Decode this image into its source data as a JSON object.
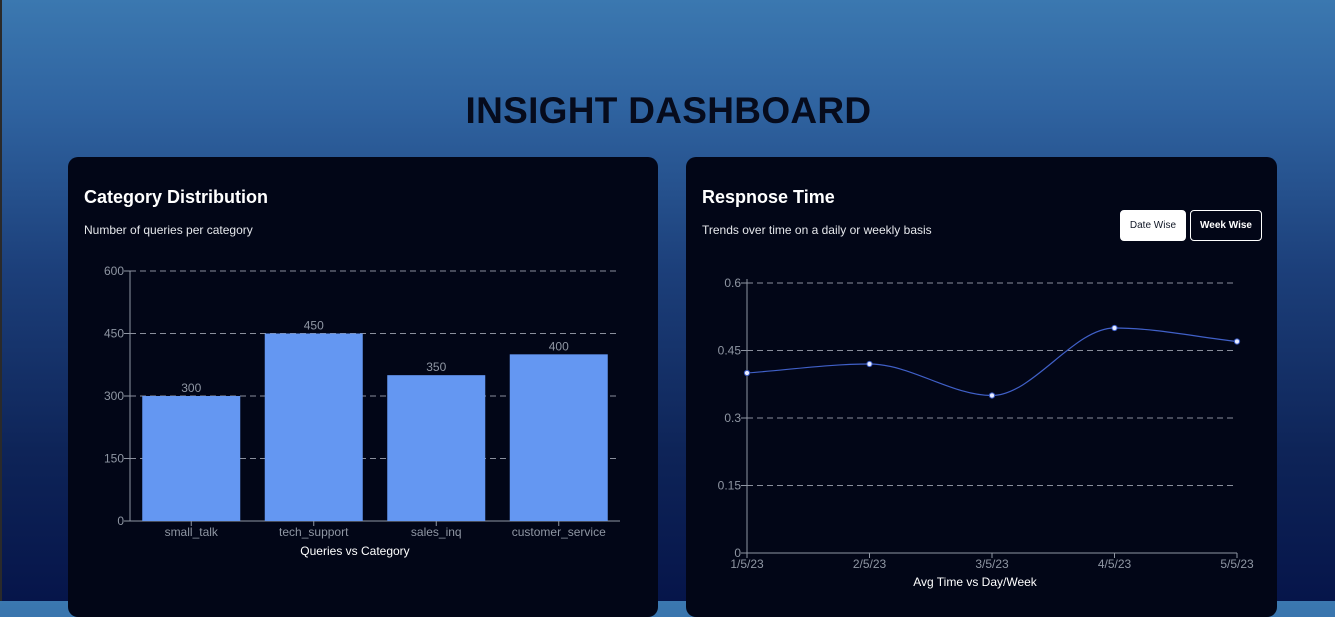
{
  "page": {
    "title": "INSIGHT DASHBOARD"
  },
  "category_card": {
    "title": "Category Distribution",
    "subtitle": "Number of queries per category"
  },
  "response_card": {
    "title": "Respnose Time",
    "subtitle": "Trends over time on a daily or weekly basis",
    "buttons": {
      "date_wise": "Date Wise",
      "week_wise": "Week Wise"
    }
  },
  "colors": {
    "bar": "#6497f2",
    "line": "#4060c8",
    "point": "#e8ecff",
    "grid": "#8a8f9c",
    "tick": "#8f96a3"
  },
  "chart_data": [
    {
      "type": "bar",
      "categories": [
        "small_talk",
        "tech_support",
        "sales_inq",
        "customer_service"
      ],
      "values": [
        300,
        450,
        350,
        400
      ],
      "data_labels": [
        "300",
        "450",
        "350",
        "400"
      ],
      "xlabel": "Queries vs Category",
      "ylabel": "",
      "ylim": [
        0,
        600
      ],
      "yticks": [
        "0",
        "150",
        "300",
        "450",
        "600"
      ],
      "grid": true
    },
    {
      "type": "line",
      "x": [
        "1/5/23",
        "2/5/23",
        "3/5/23",
        "4/5/23",
        "5/5/23"
      ],
      "values": [
        0.4,
        0.42,
        0.35,
        0.5,
        0.47
      ],
      "xlabel": "Avg Time vs Day/Week",
      "ylabel": "",
      "ylim": [
        0,
        0.6
      ],
      "yticks": [
        "0",
        "0.15",
        "0.3",
        "0.45",
        "0.6"
      ],
      "grid": true,
      "smooth": true
    }
  ]
}
